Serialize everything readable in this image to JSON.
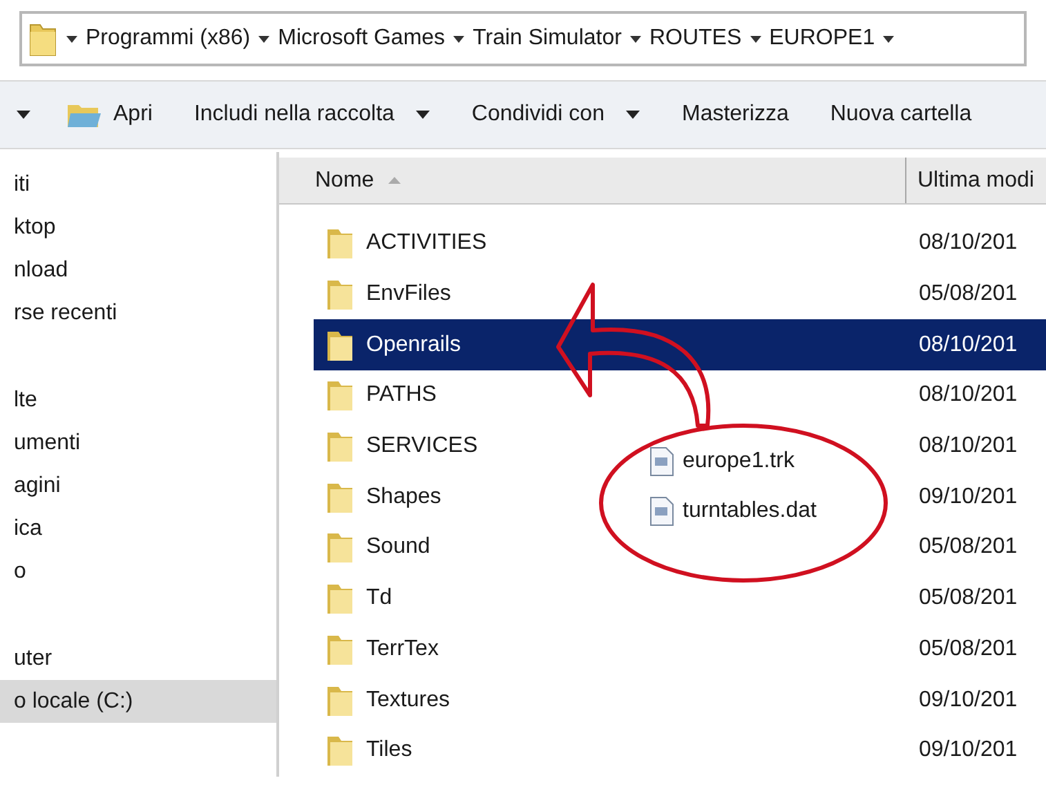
{
  "address_bar": {
    "crumbs": [
      "Programmi (x86)",
      "Microsoft Games",
      "Train Simulator",
      "ROUTES",
      "EUROPE1"
    ]
  },
  "toolbar": {
    "items": [
      {
        "label": "Apri",
        "kind": "open"
      },
      {
        "label": "Includi nella raccolta",
        "kind": "menu"
      },
      {
        "label": "Condividi con",
        "kind": "menu"
      },
      {
        "label": "Masterizza",
        "kind": "plain"
      },
      {
        "label": "Nuova cartella",
        "kind": "plain"
      }
    ]
  },
  "sidebar": {
    "items": [
      {
        "label": "iti",
        "selected": false
      },
      {
        "label": "ktop",
        "selected": false
      },
      {
        "label": "nload",
        "selected": false
      },
      {
        "label": "rse recenti",
        "selected": false
      },
      {
        "label": "lte",
        "selected": false
      },
      {
        "label": "umenti",
        "selected": false
      },
      {
        "label": "agini",
        "selected": false
      },
      {
        "label": "ica",
        "selected": false
      },
      {
        "label": "o",
        "selected": false
      },
      {
        "label": "uter",
        "selected": false
      },
      {
        "label": "o locale (C:)",
        "selected": true
      }
    ]
  },
  "file_list": {
    "columns": [
      "Nome",
      "Ultima modi"
    ],
    "rows": [
      {
        "name": "ACTIVITIES",
        "date": "08/10/201",
        "selected": false
      },
      {
        "name": "EnvFiles",
        "date": "05/08/201",
        "selected": false
      },
      {
        "name": "Openrails",
        "date": "08/10/201",
        "selected": true
      },
      {
        "name": "PATHS",
        "date": "08/10/201",
        "selected": false
      },
      {
        "name": "SERVICES",
        "date": "08/10/201",
        "selected": false
      },
      {
        "name": "Shapes",
        "date": "09/10/201",
        "selected": false
      },
      {
        "name": "Sound",
        "date": "05/08/201",
        "selected": false
      },
      {
        "name": "Td",
        "date": "05/08/201",
        "selected": false
      },
      {
        "name": "TerrTex",
        "date": "05/08/201",
        "selected": false
      },
      {
        "name": "Textures",
        "date": "09/10/201",
        "selected": false
      },
      {
        "name": "Tiles",
        "date": "09/10/201",
        "selected": false
      }
    ]
  },
  "callout": {
    "files": [
      "europe1.trk",
      "turntables.dat"
    ]
  }
}
